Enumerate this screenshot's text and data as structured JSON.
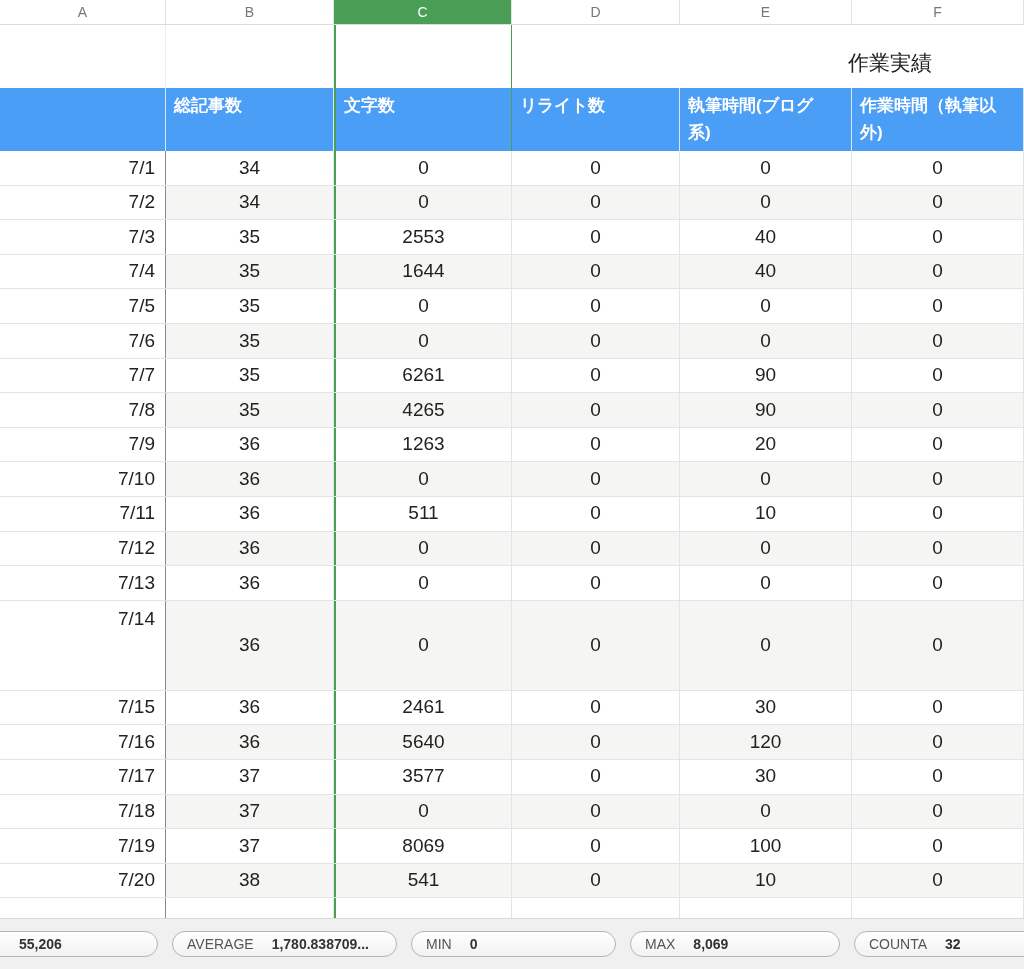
{
  "columns": [
    {
      "letter": "A",
      "selected": false
    },
    {
      "letter": "B",
      "selected": false
    },
    {
      "letter": "C",
      "selected": true
    },
    {
      "letter": "D",
      "selected": false
    },
    {
      "letter": "E",
      "selected": false
    },
    {
      "letter": "F",
      "selected": false
    }
  ],
  "title": "作業実績",
  "headers": [
    "総記事数",
    "文字数",
    "リライト数",
    "執筆時間(ブログ系)",
    "作業時間（執筆以外)"
  ],
  "rows": [
    {
      "kind": "normal",
      "cells": [
        "7/1",
        "34",
        "0",
        "0",
        "0",
        "0"
      ]
    },
    {
      "kind": "normal",
      "cells": [
        "7/2",
        "34",
        "0",
        "0",
        "0",
        "0"
      ]
    },
    {
      "kind": "normal",
      "cells": [
        "7/3",
        "35",
        "2553",
        "0",
        "40",
        "0"
      ]
    },
    {
      "kind": "normal",
      "cells": [
        "7/4",
        "35",
        "1644",
        "0",
        "40",
        "0"
      ]
    },
    {
      "kind": "normal",
      "cells": [
        "7/5",
        "35",
        "0",
        "0",
        "0",
        "0"
      ]
    },
    {
      "kind": "normal",
      "cells": [
        "7/6",
        "35",
        "0",
        "0",
        "0",
        "0"
      ]
    },
    {
      "kind": "normal",
      "cells": [
        "7/7",
        "35",
        "6261",
        "0",
        "90",
        "0"
      ]
    },
    {
      "kind": "normal",
      "cells": [
        "7/8",
        "35",
        "4265",
        "0",
        "90",
        "0"
      ]
    },
    {
      "kind": "normal",
      "cells": [
        "7/9",
        "36",
        "1263",
        "0",
        "20",
        "0"
      ]
    },
    {
      "kind": "normal",
      "cells": [
        "7/10",
        "36",
        "0",
        "0",
        "0",
        "0"
      ]
    },
    {
      "kind": "normal",
      "cells": [
        "7/11",
        "36",
        "511",
        "0",
        "10",
        "0"
      ]
    },
    {
      "kind": "normal",
      "cells": [
        "7/12",
        "36",
        "0",
        "0",
        "0",
        "0"
      ]
    },
    {
      "kind": "normal",
      "cells": [
        "7/13",
        "36",
        "0",
        "0",
        "0",
        "0"
      ]
    },
    {
      "kind": "tall",
      "cells": [
        "7/14",
        "36",
        "0",
        "0",
        "0",
        "0"
      ]
    },
    {
      "kind": "normal",
      "cells": [
        "7/15",
        "36",
        "2461",
        "0",
        "30",
        "0"
      ]
    },
    {
      "kind": "normal",
      "cells": [
        "7/16",
        "36",
        "5640",
        "0",
        "120",
        "0"
      ]
    },
    {
      "kind": "normal",
      "cells": [
        "7/17",
        "37",
        "3577",
        "0",
        "30",
        "0"
      ]
    },
    {
      "kind": "normal",
      "cells": [
        "7/18",
        "37",
        "0",
        "0",
        "0",
        "0"
      ]
    },
    {
      "kind": "normal",
      "cells": [
        "7/19",
        "37",
        "8069",
        "0",
        "100",
        "0"
      ]
    },
    {
      "kind": "normal",
      "cells": [
        "7/20",
        "38",
        "541",
        "0",
        "10",
        "0"
      ]
    }
  ],
  "status_bar": [
    {
      "value": "55,206"
    },
    {
      "label": "AVERAGE",
      "value": "1,780.838709..."
    },
    {
      "label": "MIN",
      "value": "0"
    },
    {
      "label": "MAX",
      "value": "8,069"
    },
    {
      "label": "COUNTA",
      "value": "32"
    }
  ]
}
